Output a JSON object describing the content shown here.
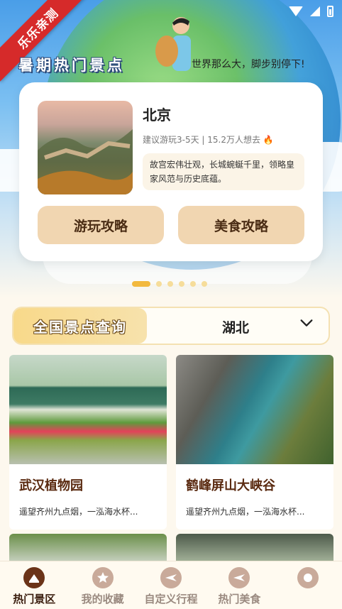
{
  "ribbon": {
    "text": "乐乐亲测"
  },
  "hero": {
    "title": "暑期热门景点",
    "slogan": "世界那么大，脚步别停下!"
  },
  "featured": {
    "city": "北京",
    "meta": "建议游玩3-5天 | 15.2万人想去",
    "fire_icon": "fire-icon",
    "description": "故宫宏伟壮观，长城蜿蜒千里，领略皇家风范与历史底蕴。",
    "buttons": {
      "play_guide": "游玩攻略",
      "food_guide": "美食攻略"
    }
  },
  "carousel": {
    "count": 6,
    "active_index": 0
  },
  "query": {
    "label": "全国景点查询",
    "selected_province": "湖北"
  },
  "spots": [
    {
      "name": "武汉植物园",
      "description": "遥望齐州九点烟，一泓海水杯..."
    },
    {
      "name": "鹤峰屏山大峡谷",
      "description": "遥望齐州九点烟，一泓海水杯..."
    }
  ],
  "nav": {
    "items": [
      {
        "label": "热门景区",
        "icon": "attraction-icon",
        "active": true
      },
      {
        "label": "我的收藏",
        "icon": "star-icon",
        "active": false
      },
      {
        "label": "自定义行程",
        "icon": "plane-icon",
        "active": false
      },
      {
        "label": "热门美食",
        "icon": "plane-icon",
        "active": false
      },
      {
        "label": "",
        "icon": "circle-icon",
        "active": false
      }
    ]
  },
  "colors": {
    "accent": "#f2b93e",
    "button_bg": "#f1d6b1",
    "nav_active": "#6b3318"
  }
}
